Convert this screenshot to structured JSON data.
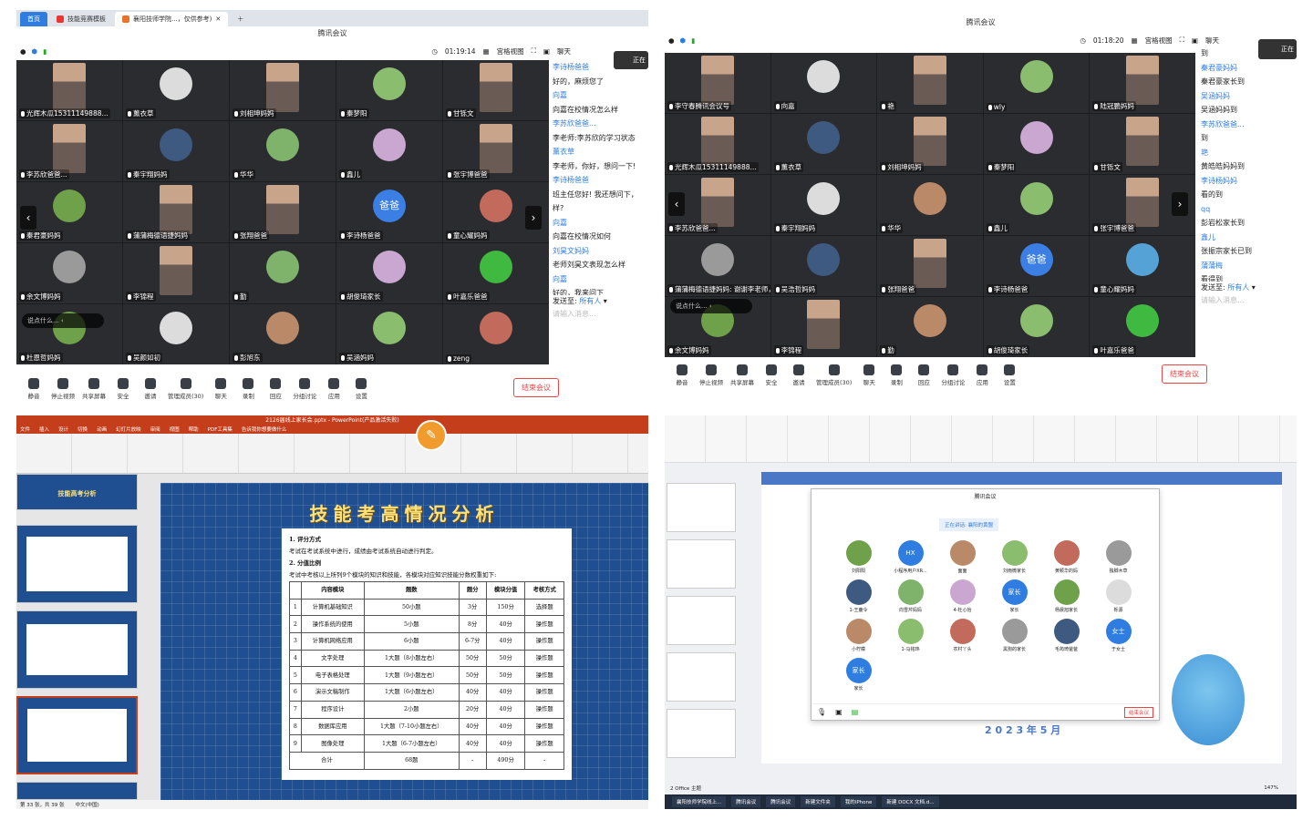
{
  "q1": {
    "tabs": [
      {
        "label": "首页"
      },
      {
        "label": "技能竞赛模板"
      },
      {
        "label": "襄阳技师学院...，仅供参考)"
      }
    ],
    "title": "腾讯会议",
    "timer": "01:19:14",
    "view": "宫格视图",
    "chat_label": "聊天",
    "speaking": "正在",
    "participants": [
      "光辉木瓜15311149888...",
      "薰衣草",
      "刘相坤妈妈",
      "秦梦阳",
      "甘铄文",
      "李苏欣爸爸...",
      "秦宇翔妈妈",
      "华华",
      "鑫儿",
      "张宇博爸爸",
      "秦君豪妈妈",
      "蒲蒲梅德语捷妈妈",
      "张翔爸爸",
      "李诗杨爸爸",
      "童心耀妈妈",
      "余文博妈妈",
      "李锦程",
      "勤",
      "胡俊琦家长",
      "叶嘉乐爸爸",
      "杜恩哲妈妈",
      "吴颜如初",
      "彭旭东",
      "吴涵妈妈",
      "zeng"
    ],
    "dad_badge": "爸爸",
    "mom_badge": "妈妈",
    "chat": [
      {
        "t": "李诗杨爸爸",
        "s": "b"
      },
      {
        "t": "好的，麻烦您了",
        "s": "k"
      },
      {
        "t": "向嘉",
        "s": "b"
      },
      {
        "t": "向嘉在校情况怎么样",
        "s": "k"
      },
      {
        "t": "李苏欣爸爸...",
        "s": "b"
      },
      {
        "t": "李老师:李苏欣的学习状态",
        "s": "k"
      },
      {
        "t": "薰衣草",
        "s": "b"
      },
      {
        "t": "李老师，你好，想问一下!",
        "s": "k"
      },
      {
        "t": "李诗杨爸爸",
        "s": "b"
      },
      {
        "t": "班主任您好! 我还想问下，",
        "s": "k"
      },
      {
        "t": "样?",
        "s": "k"
      },
      {
        "t": "向嘉",
        "s": "b"
      },
      {
        "t": "向嘉在校情况如何",
        "s": "k"
      },
      {
        "t": "刘昊文妈妈",
        "s": "b"
      },
      {
        "t": "老师刘昊文表现怎么样",
        "s": "k"
      },
      {
        "t": "向嘉",
        "s": "b"
      },
      {
        "t": "好的，我来问下",
        "s": "k"
      }
    ],
    "send_to": "发送至:",
    "send_target": "所有人",
    "input_placeholder": "请输入消息...",
    "say_something": "说点什么...",
    "toolbar": [
      "静音",
      "停止视频",
      "共享屏幕",
      "安全",
      "邀请",
      "管理成员(30)",
      "聊天",
      "录制",
      "回应",
      "分组讨论",
      "应用",
      "设置"
    ],
    "end": "结束会议"
  },
  "q2": {
    "title": "腾讯会议",
    "timer": "01:18:20",
    "view": "宫格视图",
    "chat_label": "聊天",
    "speaking": "正在",
    "participants": [
      "李守春腾讯会议号",
      "向嘉",
      "艳",
      "wly",
      "陆冠鹏妈妈",
      "光辉木瓜15311149888...",
      "薰衣草",
      "刘相坤妈妈",
      "秦梦阳",
      "甘铄文",
      "李苏欣爸爸...",
      "秦宇翔妈妈",
      "华华",
      "鑫儿",
      "张宇博爸爸",
      "蒲蒲梅德语捷妈妈: 谢谢李老师，辛苦了",
      "吴浩哲妈妈",
      "张翔爸爸",
      "李诗杨爸爸",
      "童心耀妈妈",
      "余文博妈妈",
      "李锦程",
      "勤",
      "胡俊琦家长",
      "叶嘉乐爸爸"
    ],
    "dad_badge": "爸爸",
    "chat": [
      {
        "t": "到",
        "s": "k"
      },
      {
        "t": "秦君豪妈妈",
        "s": "b"
      },
      {
        "t": "秦君豪家长到",
        "s": "k"
      },
      {
        "t": "吴涵妈妈",
        "s": "b"
      },
      {
        "t": "吴涵妈妈到",
        "s": "k"
      },
      {
        "t": "李苏欣爸爸...",
        "s": "b"
      },
      {
        "t": "到",
        "s": "k"
      },
      {
        "t": "艳",
        "s": "b"
      },
      {
        "t": "黄皓皓妈妈到",
        "s": "k"
      },
      {
        "t": "李诗杨妈妈",
        "s": "b"
      },
      {
        "t": "看的到",
        "s": "k"
      },
      {
        "t": "qq",
        "s": "b"
      },
      {
        "t": "彭岩松家长到",
        "s": "k"
      },
      {
        "t": "鑫儿",
        "s": "b"
      },
      {
        "t": "张振宗家长已到",
        "s": "k"
      },
      {
        "t": "蒲蒲梅",
        "s": "b"
      },
      {
        "t": "看得到",
        "s": "k"
      }
    ],
    "send_to": "发送至:",
    "send_target": "所有人",
    "input_placeholder": "请输入消息...",
    "say_something": "说点什么...",
    "toolbar": [
      "静音",
      "停止视频",
      "共享屏幕",
      "安全",
      "邀请",
      "管理成员(30)",
      "聊天",
      "录制",
      "回应",
      "分组讨论",
      "应用",
      "设置"
    ],
    "end": "结束会议"
  },
  "q3": {
    "window_title": "2126届线上家长会.pptx - PowerPoint(产品激活失败)",
    "ribbon_tabs": [
      "文件",
      "插入",
      "设计",
      "切换",
      "动画",
      "幻灯片放映",
      "审阅",
      "视图",
      "帮助",
      "PDF工具集",
      "告诉我你想要做什么"
    ],
    "thumb_title": "技能高考分析",
    "slide_title": "技能考高情况分析",
    "sec1": "1. 评分方式",
    "sec1_text": "考试在考试系统中进行，成绩由考试系统自动进行判定。",
    "sec2": "2. 分值比例",
    "sec2_text": "考试中考核以上所列9个模块的知识和技能，各模块对应知识技能分数权重如下:",
    "headers": [
      "内容模块",
      "题数",
      "题分",
      "模块分值",
      "考核方式"
    ],
    "rows": [
      [
        "1",
        "计算机基础知识",
        "50小题",
        "3分",
        "150分",
        "选择题"
      ],
      [
        "2",
        "操作系统的使用",
        "5小题",
        "8分",
        "40分",
        "操作题"
      ],
      [
        "3",
        "计算机网络应用",
        "6小题",
        "6-7分",
        "40分",
        "操作题"
      ],
      [
        "4",
        "文字处理",
        "1大题（8小题左右）",
        "50分",
        "50分",
        "操作题"
      ],
      [
        "5",
        "电子表格处理",
        "1大题（9小题左右）",
        "50分",
        "50分",
        "操作题"
      ],
      [
        "6",
        "演示文稿制作",
        "1大题（6小题左右）",
        "40分",
        "40分",
        "操作题"
      ],
      [
        "7",
        "程序设计",
        "2小题",
        "20分",
        "40分",
        "操作题"
      ],
      [
        "8",
        "数据库应用",
        "1大题（7-10小题左右）",
        "40分",
        "40分",
        "操作题"
      ],
      [
        "9",
        "图像处理",
        "1大题（6-7小题左右）",
        "40分",
        "40分",
        "操作题"
      ]
    ],
    "total": [
      "合计",
      "",
      "68题",
      "-",
      "490分",
      "-"
    ],
    "status": "第 33 张，共 39 张",
    "lang": "中文(中国)"
  },
  "q4": {
    "title": "腾讯会议",
    "notice": "正在讲话: 襄阳的黄盟",
    "date_text": "2 0 2 3 年 5 月",
    "names": [
      "刘阳阳",
      "小程序用户XR...",
      "面面",
      "刘雨微家长",
      "黄颖华的妈",
      "独脚木草",
      "1-王鹿令",
      "向雪芹妈妈",
      "4-杜心怡",
      "家长",
      "杨晨旭家长",
      "栎源",
      "小柠檬",
      "1-马铭玮",
      "农村丫头",
      "黑狗的家长",
      "毛筠琦爸爸",
      "于女士",
      "家长"
    ],
    "badges": [
      "HX",
      "家长",
      "女士",
      "家长"
    ],
    "end": "结束会议",
    "status_left": "2 Office 主题",
    "taskbar": [
      "襄阳技师学院线上...",
      "腾讯会议",
      "腾讯会议",
      "新建文件夹",
      "我的iPhone",
      "新建 DOCX 文档.d..."
    ],
    "zoom": "147%"
  }
}
